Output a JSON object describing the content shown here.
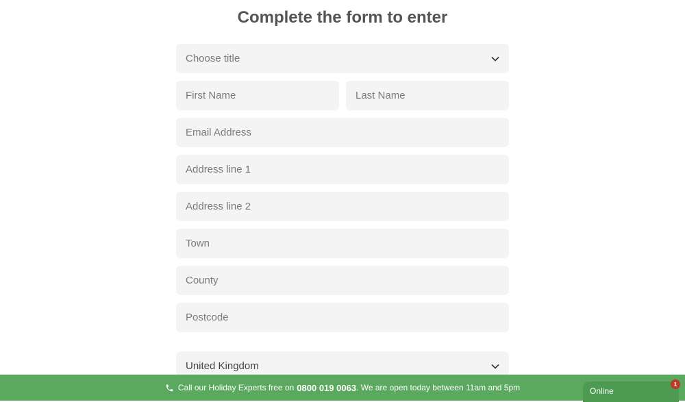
{
  "form": {
    "heading": "Complete the form to enter",
    "title_select": "Choose title",
    "first_name": "First Name",
    "last_name": "Last Name",
    "email": "Email Address",
    "address1": "Address line 1",
    "address2": "Address line 2",
    "town": "Town",
    "county": "County",
    "postcode": "Postcode",
    "country": "United Kingdom"
  },
  "footer": {
    "prefix": "Call our Holiday Experts free on",
    "phone": "0800 019 0063",
    "suffix": ". We are open today between 11am and 5pm"
  },
  "chat": {
    "status": "Online",
    "badge_count": "1"
  },
  "colors": {
    "footer_bg": "#5ba95f",
    "field_bg": "#f4f4f4",
    "badge": "#c0392b"
  }
}
